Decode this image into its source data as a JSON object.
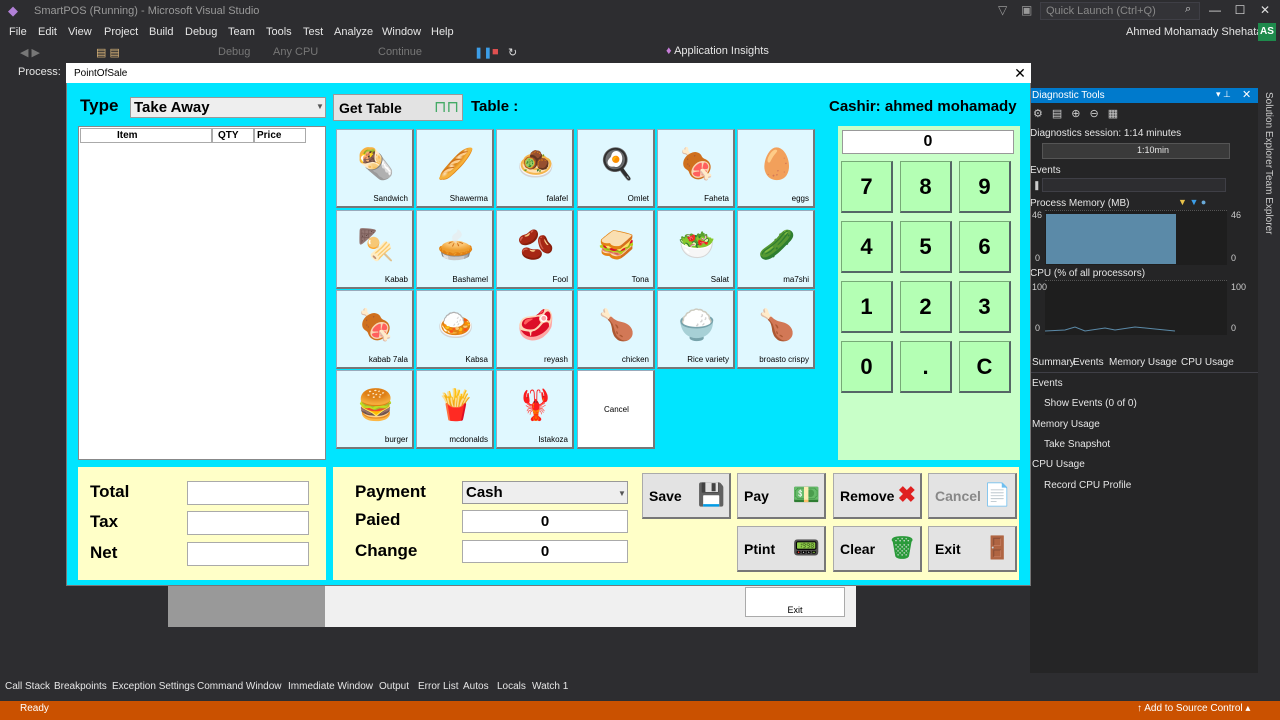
{
  "vs": {
    "title": "SmartPOS (Running) - Microsoft Visual Studio",
    "quick_launch_placeholder": "Quick Launch (Ctrl+Q)",
    "menu": [
      "File",
      "Edit",
      "View",
      "Project",
      "Build",
      "Debug",
      "Team",
      "Tools",
      "Test",
      "Analyze",
      "Window",
      "Help"
    ],
    "user": "Ahmed Mohamady Shehata",
    "avatar": "AS",
    "toolbar": {
      "config": "Debug",
      "platform": "Any CPU",
      "continue": "Continue",
      "app_insights": "Application Insights"
    },
    "process_label": "Process:",
    "diagnostics": {
      "title": "Diagnostic Tools",
      "session": "Diagnostics session: 1:14 minutes",
      "time_mark": "1:10min",
      "events": "Events",
      "process_memory": "Process Memory (MB)",
      "mem_max": "46",
      "mem_min": "0",
      "mem_max_r": "46",
      "mem_min_r": "0",
      "cpu": "CPU (% of all processors)",
      "cpu_max": "100",
      "cpu_min": "0",
      "cpu_max_r": "100",
      "cpu_min_r": "0",
      "tabs": [
        "Summary",
        "Events",
        "Memory Usage",
        "CPU Usage"
      ],
      "list": [
        "Events",
        "Show Events (0 of 0)",
        "Memory Usage",
        "Take Snapshot",
        "CPU Usage",
        "Record CPU Profile"
      ]
    },
    "side_tabs": [
      "Solution Explorer",
      "Team Explorer"
    ],
    "bottom_tabs": [
      "Call Stack",
      "Breakpoints",
      "Exception Settings",
      "Command Window",
      "Immediate Window",
      "Output",
      "Error List",
      "Autos",
      "Locals",
      "Watch 1"
    ],
    "status": "Ready",
    "source_control": "Add to Source Control",
    "bg_exit": "Exit"
  },
  "pos": {
    "title": "PointOfSale",
    "type_label": "Type",
    "type_value": "Take Away",
    "get_table": "Get Table",
    "table_label": "Table :",
    "cashier": "Cashir: ahmed mohamady",
    "grid_headers": {
      "item": "Item",
      "qty": "QTY",
      "price": "Price"
    },
    "products": [
      {
        "label": "Sandwich",
        "icon": "🌯"
      },
      {
        "label": "Shawerma",
        "icon": "🥖"
      },
      {
        "label": "falafel",
        "icon": "🧆"
      },
      {
        "label": "Omlet",
        "icon": "🍳"
      },
      {
        "label": "Faheta",
        "icon": "🍖"
      },
      {
        "label": "eggs",
        "icon": "🥚"
      },
      {
        "label": "Kabab",
        "icon": "🍢"
      },
      {
        "label": "Bashamel",
        "icon": "🥧"
      },
      {
        "label": "Fool",
        "icon": "🫘"
      },
      {
        "label": "Tona",
        "icon": "🥪"
      },
      {
        "label": "Salat",
        "icon": "🥗"
      },
      {
        "label": "ma7shi",
        "icon": "🥒"
      },
      {
        "label": "kabab 7ala",
        "icon": "🍖"
      },
      {
        "label": "Kabsa",
        "icon": "🍛"
      },
      {
        "label": "reyash",
        "icon": "🥩"
      },
      {
        "label": "chicken",
        "icon": "🍗"
      },
      {
        "label": "Rice variety",
        "icon": "🍚"
      },
      {
        "label": "broasto crispy",
        "icon": "🍗"
      },
      {
        "label": "burger",
        "icon": "🍔"
      },
      {
        "label": "mcdonalds",
        "icon": "🍟"
      },
      {
        "label": "Istakoza",
        "icon": "🦞"
      }
    ],
    "cancel_product": "Cancel",
    "display": "0",
    "keys": [
      "7",
      "8",
      "9",
      "4",
      "5",
      "6",
      "1",
      "2",
      "3",
      "0",
      ".",
      "C"
    ],
    "totals": {
      "total": "Total",
      "tax": "Tax",
      "net": "Net"
    },
    "payment": {
      "payment_label": "Payment",
      "payment_value": "Cash",
      "paied_label": "Paied",
      "paied_value": "0",
      "change_label": "Change",
      "change_value": "0"
    },
    "buttons": {
      "save": "Save",
      "pay": "Pay",
      "remove": "Remove",
      "cancel": "Cancel",
      "print": "Ptint",
      "clear": "Clear",
      "exit": "Exit"
    }
  }
}
